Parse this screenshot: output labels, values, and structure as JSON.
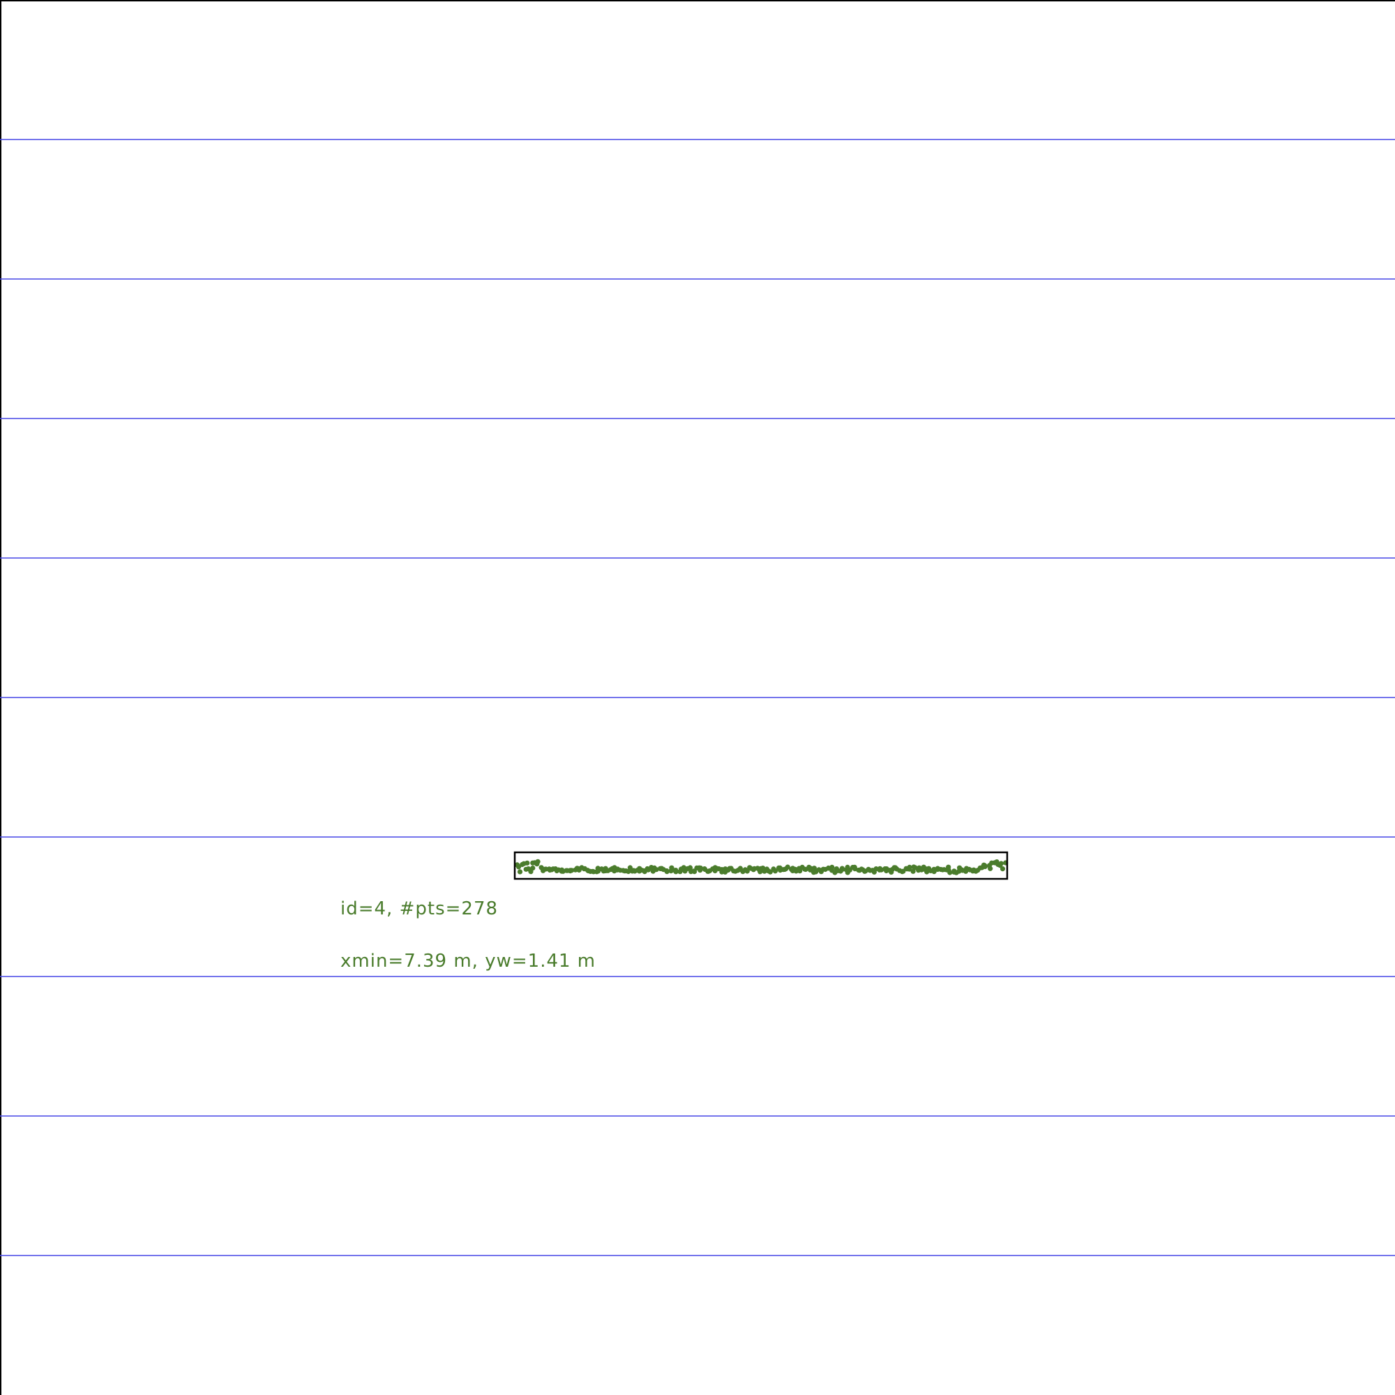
{
  "cluster": {
    "id_label": "id=4, #pts=278",
    "extent_label": "xmin=7.39 m, yw=1.41 m",
    "point_count": 278,
    "point_color": "#4a7c2c"
  },
  "colors": {
    "lane_line": "#4646e6",
    "border": "#000000",
    "box": "#000000"
  }
}
